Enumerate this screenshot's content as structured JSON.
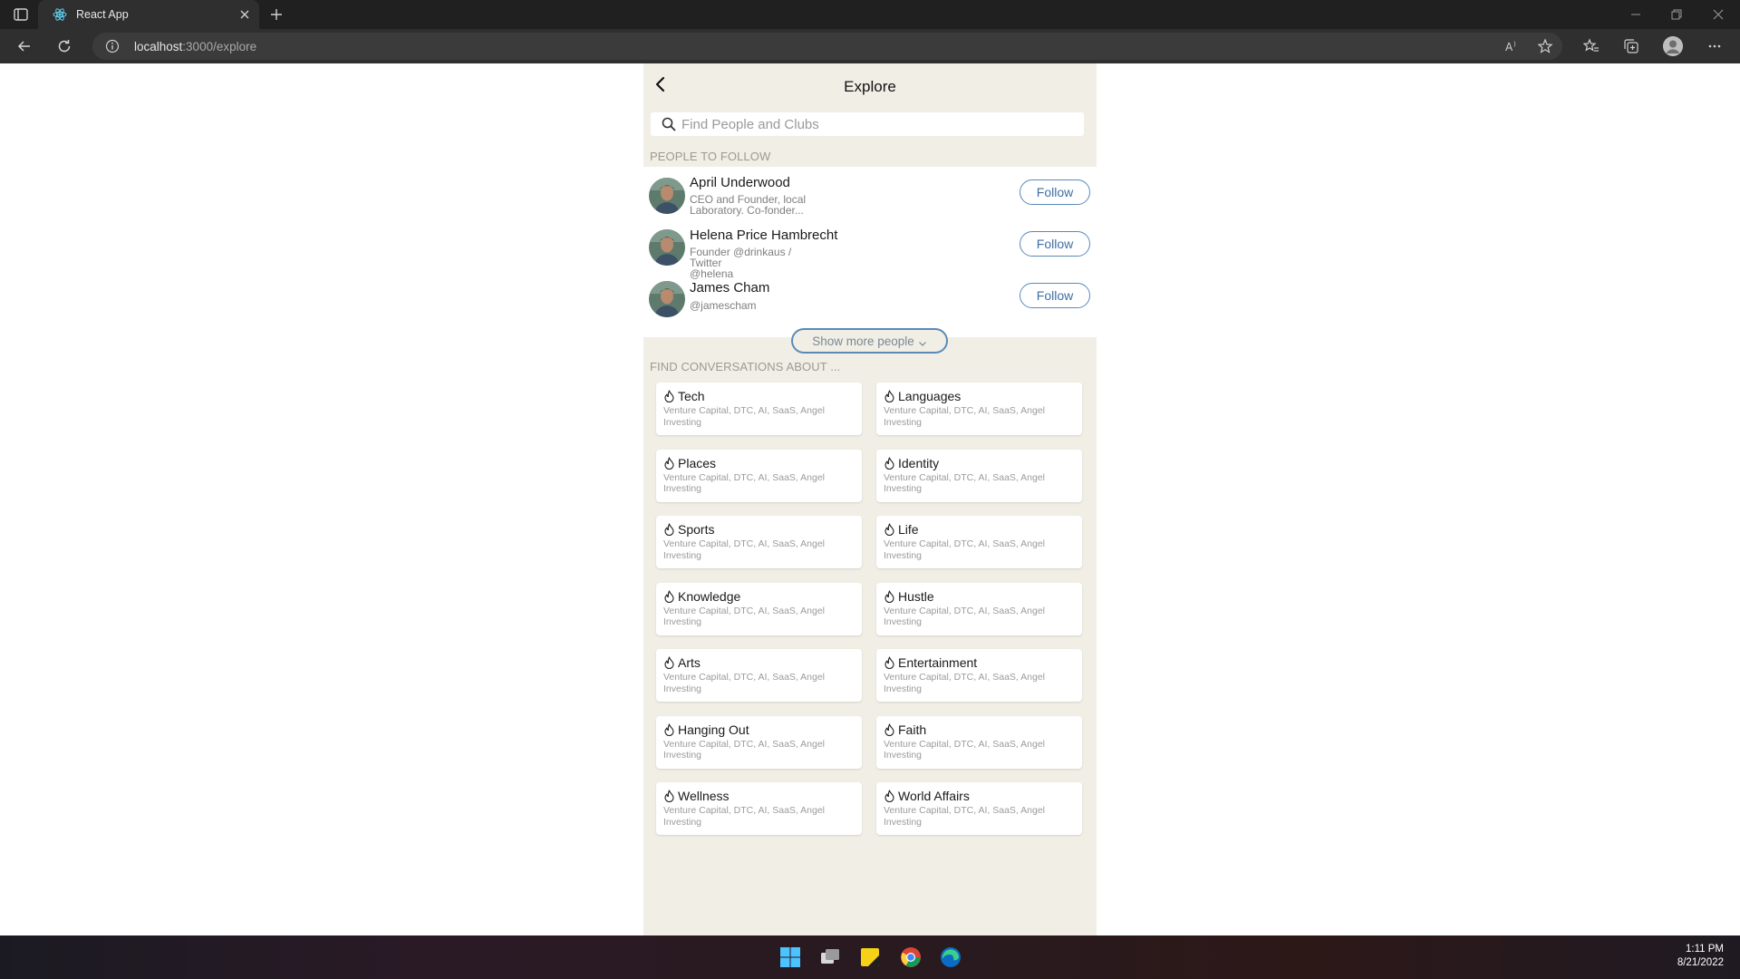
{
  "browser": {
    "tab_title": "React App",
    "url_host": "localhost",
    "url_rest": ":3000/explore"
  },
  "header": {
    "title": "Explore"
  },
  "search": {
    "placeholder": "Find People and Clubs"
  },
  "people_section": {
    "title": "PEOPLE TO FOLLOW",
    "follow_label": "Follow",
    "people": [
      {
        "name": "April Underwood",
        "bio_line1": "CEO and Founder, local",
        "bio_line2": "Laboratory. Co-fonder..."
      },
      {
        "name": "Helena Price Hambrecht",
        "bio_line1": "Founder @drinkaus / Twitter",
        "bio_line2": "@helena"
      },
      {
        "name": "James Cham",
        "bio_line1": "@jamescham",
        "bio_line2": ""
      }
    ],
    "show_more_label": "Show more people"
  },
  "topics_section": {
    "title": "FIND CONVERSATIONS ABOUT ...",
    "subtitle_line1": "Venture Capital, DTC, AI, SaaS, Angel",
    "subtitle_line2": "Investing",
    "topics": [
      "Tech",
      "Languages",
      "Places",
      "Identity",
      "Sports",
      "Life",
      "Knowledge",
      "Hustle",
      "Arts",
      "Entertainment",
      "Hanging Out",
      "Faith",
      "Wellness",
      "World Affairs"
    ]
  },
  "taskbar": {
    "time": "1:11 PM",
    "date": "8/21/2022"
  },
  "colors": {
    "page_bg": "#f1efe5",
    "accent": "#5a8ab8",
    "browser_dark": "#202020"
  }
}
